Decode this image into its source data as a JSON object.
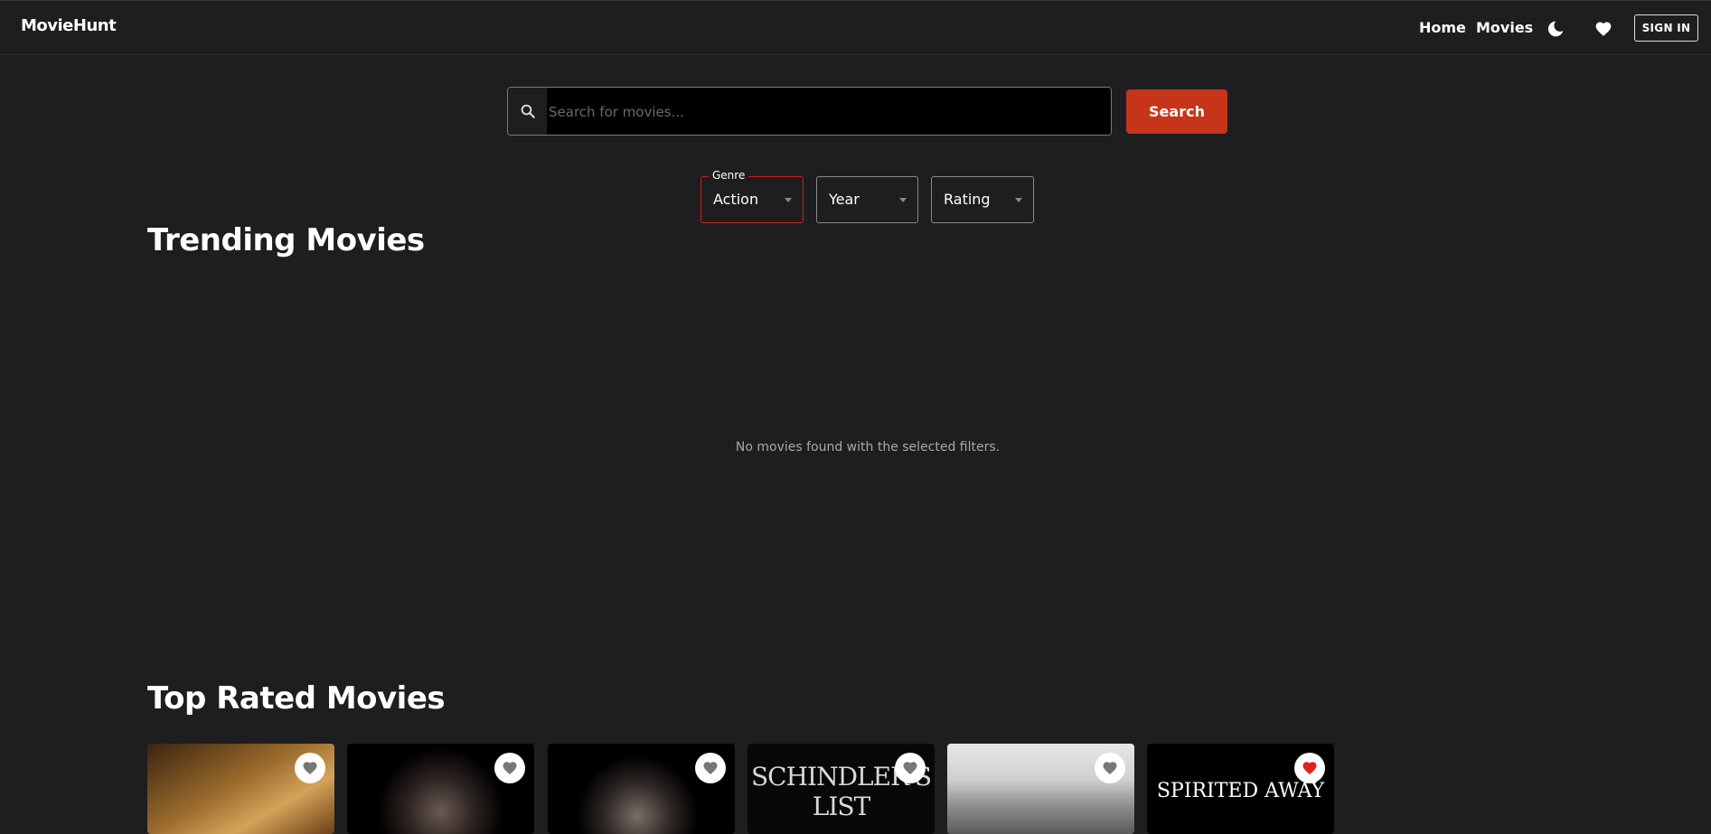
{
  "nav": {
    "brand": "MovieHunt",
    "links": [
      "Home",
      "Movies"
    ],
    "signin": "SIGN IN"
  },
  "search": {
    "placeholder": "Search for movies...",
    "button": "Search"
  },
  "filters": {
    "genre_label": "Genre",
    "genre_value": "Action",
    "year_value": "Year",
    "rating_value": "Rating"
  },
  "sections": {
    "trending_title": "Trending Movies",
    "empty_message": "No movies found with the selected filters.",
    "top_title": "Top Rated Movies"
  },
  "top_rated": [
    {
      "poster_text": "",
      "favorited": false
    },
    {
      "poster_text": "",
      "favorited": false
    },
    {
      "poster_text": "",
      "favorited": false
    },
    {
      "poster_text": "SCHINDLER'S LIST",
      "favorited": false
    },
    {
      "poster_text": "",
      "favorited": false
    },
    {
      "poster_text": "SPIRITED AWAY",
      "favorited": true
    }
  ],
  "colors": {
    "accent": "#c6341a",
    "background": "#1e1d20",
    "favorite_active": "#e02020",
    "favorite_inactive": "#777777"
  }
}
